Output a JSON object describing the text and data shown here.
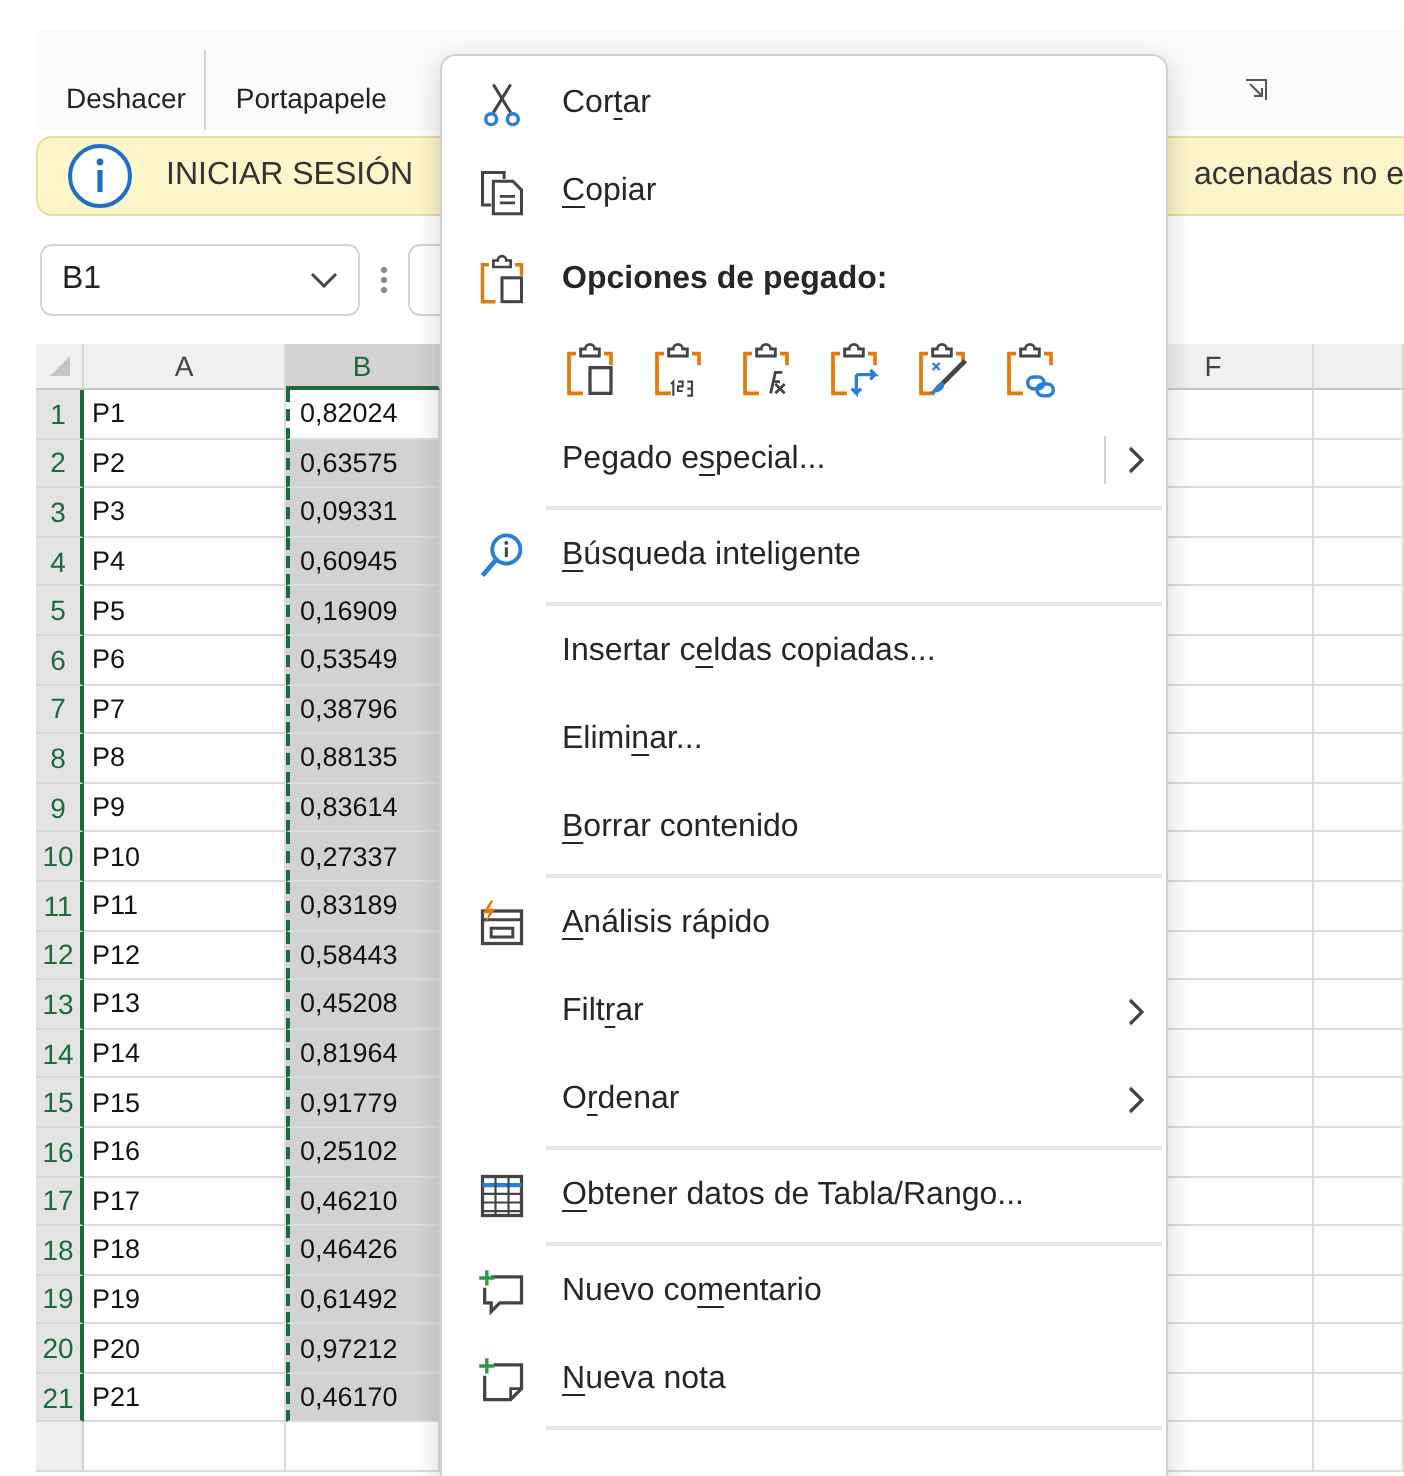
{
  "ribbon": {
    "groups": [
      {
        "label": "Deshacer"
      },
      {
        "label": "Portapapele"
      }
    ]
  },
  "info_bar": {
    "title": "INICIAR SESIÓN",
    "message": "acenadas no e"
  },
  "name_box": {
    "value": "B1"
  },
  "sheet": {
    "columns": [
      {
        "label": "A",
        "selected": false
      },
      {
        "label": "B",
        "selected": true
      },
      {
        "label": "F",
        "selected": false
      }
    ],
    "rows": [
      {
        "number": "1",
        "selected": true,
        "cells": [
          "P1",
          "0,82024"
        ]
      },
      {
        "number": "2",
        "selected": true,
        "cells": [
          "P2",
          "0,63575"
        ]
      },
      {
        "number": "3",
        "selected": true,
        "cells": [
          "P3",
          "0,09331"
        ]
      },
      {
        "number": "4",
        "selected": true,
        "cells": [
          "P4",
          "0,60945"
        ]
      },
      {
        "number": "5",
        "selected": true,
        "cells": [
          "P5",
          "0,16909"
        ]
      },
      {
        "number": "6",
        "selected": true,
        "cells": [
          "P6",
          "0,53549"
        ]
      },
      {
        "number": "7",
        "selected": true,
        "cells": [
          "P7",
          "0,38796"
        ]
      },
      {
        "number": "8",
        "selected": true,
        "cells": [
          "P8",
          "0,88135"
        ]
      },
      {
        "number": "9",
        "selected": true,
        "cells": [
          "P9",
          "0,83614"
        ]
      },
      {
        "number": "10",
        "selected": true,
        "cells": [
          "P10",
          "0,27337"
        ]
      },
      {
        "number": "11",
        "selected": true,
        "cells": [
          "P11",
          "0,83189"
        ]
      },
      {
        "number": "12",
        "selected": true,
        "cells": [
          "P12",
          "0,58443"
        ]
      },
      {
        "number": "13",
        "selected": true,
        "cells": [
          "P13",
          "0,45208"
        ]
      },
      {
        "number": "14",
        "selected": true,
        "cells": [
          "P14",
          "0,81964"
        ]
      },
      {
        "number": "15",
        "selected": true,
        "cells": [
          "P15",
          "0,91779"
        ]
      },
      {
        "number": "16",
        "selected": true,
        "cells": [
          "P16",
          "0,25102"
        ]
      },
      {
        "number": "17",
        "selected": true,
        "cells": [
          "P17",
          "0,46210"
        ]
      },
      {
        "number": "18",
        "selected": true,
        "cells": [
          "P18",
          "0,46426"
        ]
      },
      {
        "number": "19",
        "selected": true,
        "cells": [
          "P19",
          "0,61492"
        ]
      },
      {
        "number": "20",
        "selected": true,
        "cells": [
          "P20",
          "0,97212"
        ]
      },
      {
        "number": "21",
        "selected": true,
        "cells": [
          "P21",
          "0,46170"
        ]
      }
    ]
  },
  "context_menu": {
    "items": [
      {
        "kind": "command",
        "label": {
          "before": "Cor",
          "key": "t",
          "after": "ar"
        },
        "submenu": false
      },
      {
        "kind": "command",
        "label": {
          "key": "C",
          "after": "opiar"
        },
        "submenu": false
      },
      {
        "kind": "heading",
        "label": {
          "before": "Opciones de pegado:"
        }
      },
      {
        "kind": "paste_row"
      },
      {
        "kind": "command",
        "label": {
          "before": "Pegado e",
          "key": "s",
          "after": "pecial..."
        },
        "submenu": true
      },
      {
        "kind": "separator"
      },
      {
        "kind": "command",
        "label": {
          "key": "B",
          "after": "úsqueda inteligente"
        },
        "submenu": false
      },
      {
        "kind": "separator"
      },
      {
        "kind": "command",
        "label": {
          "before": "Insertar c",
          "key": "e",
          "after": "ldas copiadas..."
        },
        "submenu": false
      },
      {
        "kind": "command",
        "label": {
          "before": "Elimi",
          "key": "n",
          "after": "ar..."
        },
        "submenu": false
      },
      {
        "kind": "command",
        "label": {
          "key": "B",
          "after": "orrar contenido"
        },
        "submenu": false
      },
      {
        "kind": "separator"
      },
      {
        "kind": "command",
        "label": {
          "key": "A",
          "after": "nálisis rápido"
        },
        "submenu": false
      },
      {
        "kind": "command",
        "label": {
          "before": "Filt",
          "key": "r",
          "after": "ar"
        },
        "submenu": true
      },
      {
        "kind": "command",
        "label": {
          "before": "O",
          "key": "r",
          "after": "denar"
        },
        "submenu": true
      },
      {
        "kind": "separator"
      },
      {
        "kind": "command",
        "label": {
          "key": "O",
          "after": "btener datos de Tabla/Rango..."
        },
        "submenu": false
      },
      {
        "kind": "separator"
      },
      {
        "kind": "command",
        "label": {
          "before": "Nuevo co",
          "key": "m",
          "after": "entario"
        },
        "submenu": false
      },
      {
        "kind": "command",
        "label": {
          "key": "N",
          "after": "ueva nota"
        },
        "submenu": false
      },
      {
        "kind": "separator"
      }
    ]
  }
}
